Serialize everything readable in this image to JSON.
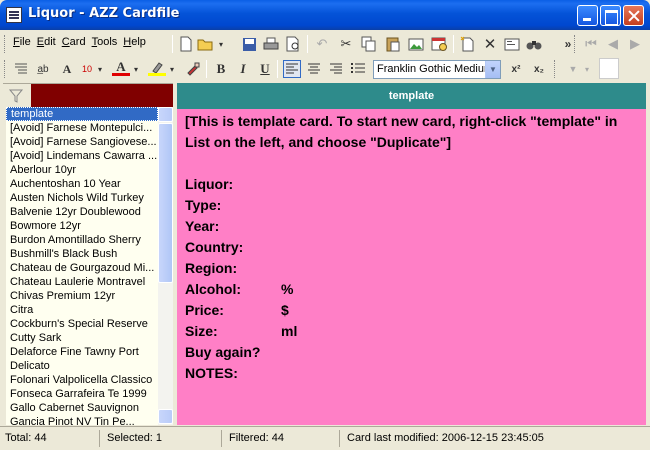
{
  "window": {
    "title": "Liquor - AZZ Cardfile"
  },
  "menu": [
    "File",
    "Edit",
    "Card",
    "Tools",
    "Help"
  ],
  "toolbar": {
    "font_size": "10",
    "font_name": "Franklin Gothic Mediur",
    "bold": "B",
    "italic": "I",
    "underline": "U",
    "superscript": "x²",
    "subscript": "x₂",
    "overflow": "»"
  },
  "list": {
    "items": [
      "template",
      "[Avoid] Farnese Montepulci...",
      "[Avoid] Farnese Sangiovese...",
      "[Avoid] Lindemans Cawarra ...",
      "Aberlour 10yr",
      "Auchentoshan 10 Year",
      "Austen Nichols Wild Turkey",
      "Balvenie 12yr Doublewood",
      "Bowmore 12yr",
      "Burdon Amontillado Sherry",
      "Bushmill's Black Bush",
      "Chateau de Gourgazoud Mi...",
      "Chateau Laulerie Montravel",
      "Chivas Premium 12yr",
      "Citra",
      "Cockburn's Special Reserve",
      "Cutty Sark",
      "Delaforce Fine Tawny Port",
      "Delicato",
      "Folonari Valpolicella Classico",
      "Fonseca Garrafeira Te 1999",
      "Gallo Cabernet Sauvignon",
      "Gancia Pinot NV Tin Pe..."
    ],
    "selected_index": 0
  },
  "card": {
    "title": "template",
    "intro": "[This is template card. To start new card, right-click \"template\" in List on the left, and choose \"Duplicate\"]",
    "fields": [
      {
        "label": "Liquor:",
        "value": ""
      },
      {
        "label": "Type:",
        "value": ""
      },
      {
        "label": "Year:",
        "value": ""
      },
      {
        "label": "Country:",
        "value": ""
      },
      {
        "label": "Region:",
        "value": ""
      },
      {
        "label": "Alcohol:",
        "value": "%"
      },
      {
        "label": "Price:",
        "value": "$"
      },
      {
        "label": "Size:",
        "value": "ml"
      },
      {
        "label": "Buy again?",
        "value": ""
      },
      {
        "label": "NOTES:",
        "value": ""
      }
    ]
  },
  "status": {
    "total": "Total: 44",
    "selected": "Selected: 1",
    "filtered": "Filtered: 44",
    "modified": "Card last modified: 2006-12-15  23:45:05"
  },
  "colors": {
    "card_background": "#FF7FC6",
    "card_header": "#2E8B8B",
    "filter_field": "#800000",
    "list_background": "#FFFFF0",
    "selection": "#316AC5"
  }
}
